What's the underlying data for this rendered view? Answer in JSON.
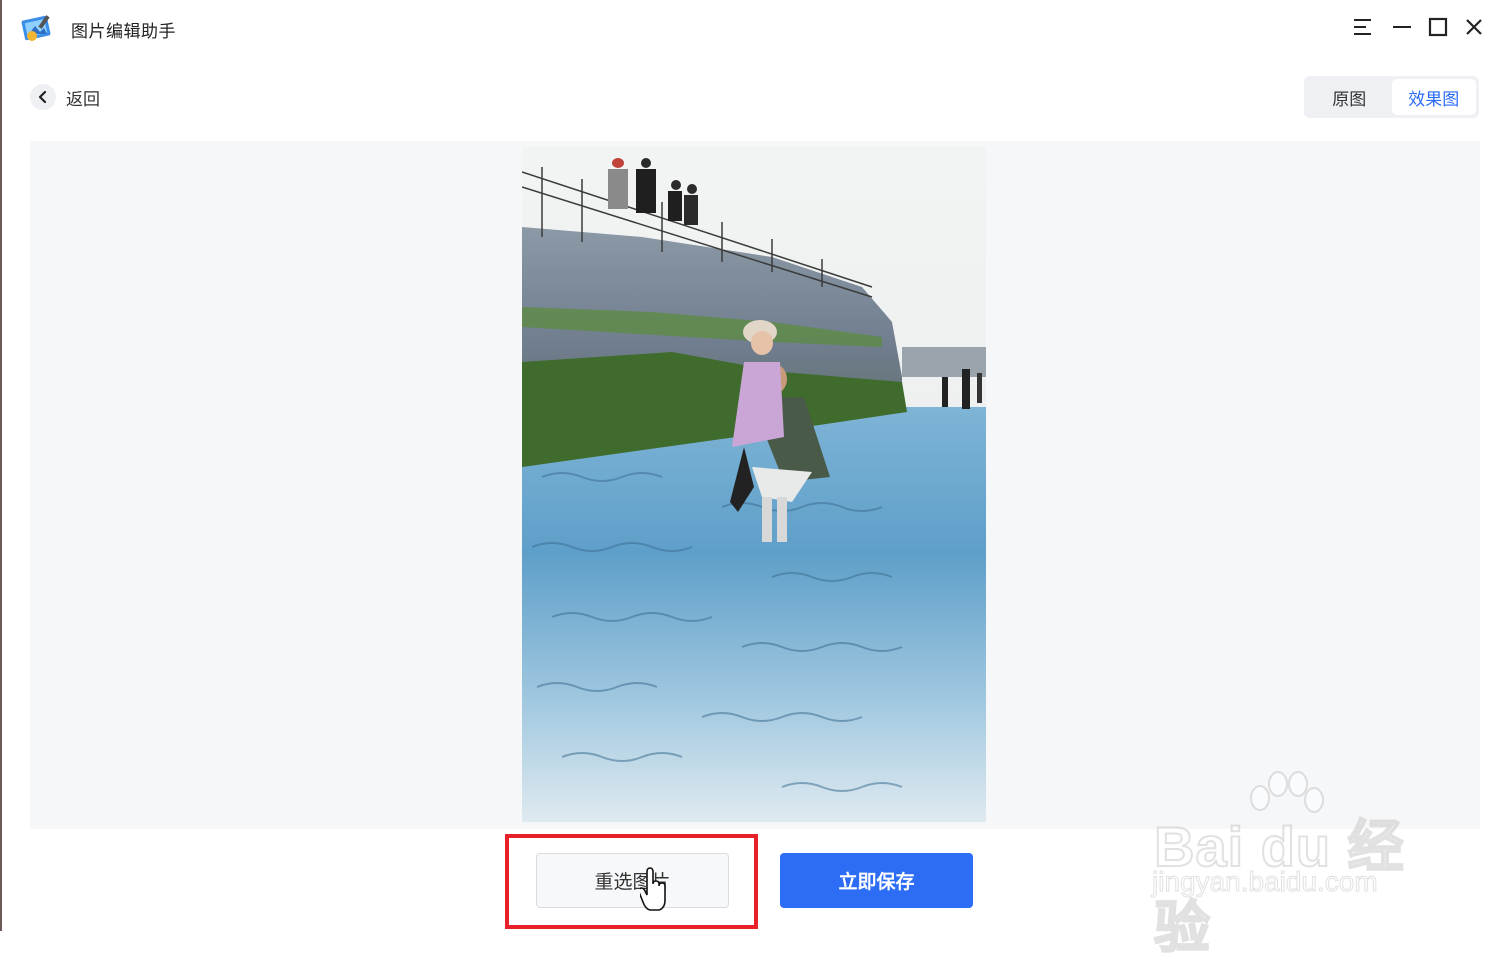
{
  "window": {
    "title": "图片编辑助手",
    "controls": [
      "menu-icon",
      "minimize-icon",
      "maximize-icon",
      "close-icon"
    ]
  },
  "toolbar": {
    "back_label": "返回",
    "view_toggle": [
      {
        "label": "原图",
        "active": false
      },
      {
        "label": "效果图",
        "active": true
      }
    ]
  },
  "preview": {
    "image_icon": "colorized-photo-preview"
  },
  "actions": {
    "reselect_label": "重选图片",
    "save_label": "立即保存"
  },
  "watermark": {
    "brand": "Bai du 经验",
    "url": "jingyan.baidu.com"
  },
  "colors": {
    "accent": "#2d6df6",
    "highlight": "#e8202a",
    "preview_bg": "#f6f7f9"
  }
}
